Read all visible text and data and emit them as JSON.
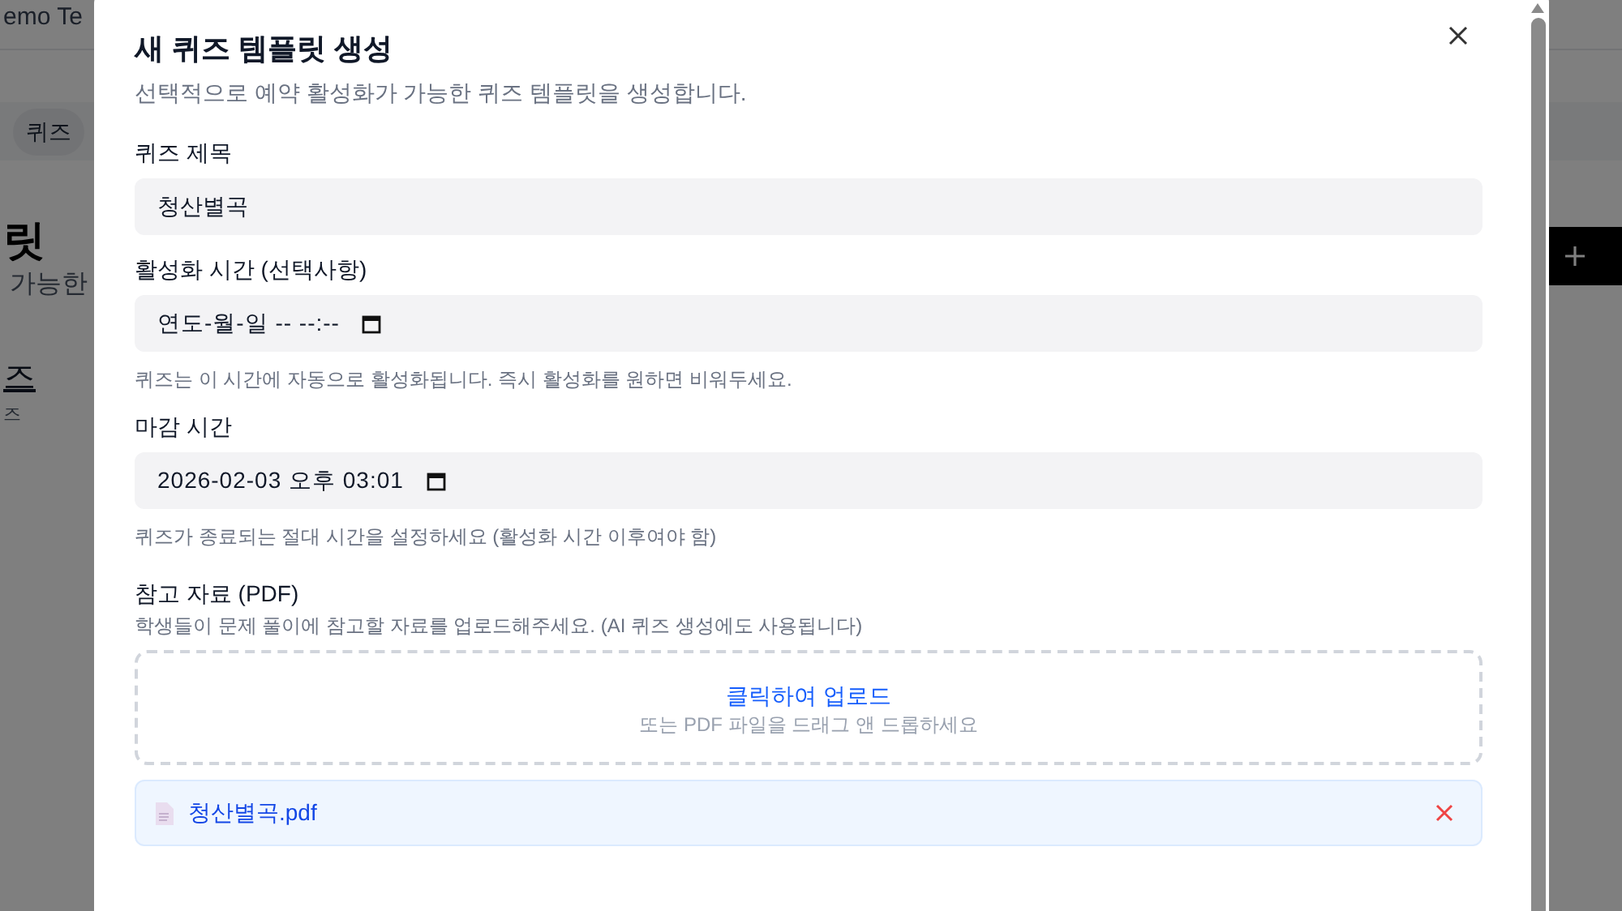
{
  "background": {
    "header_text": "emo Te",
    "chip": "퀴즈",
    "heading": "릿",
    "subheading": "가능한",
    "item_title": "즈",
    "item_sub": "즈"
  },
  "dialog": {
    "title": "새 퀴즈 템플릿 생성",
    "description": "선택적으로 예약 활성화가 가능한 퀴즈 템플릿을 생성합니다.",
    "fields": [
      {
        "kind": "text",
        "label": "퀴즈 제목",
        "value": "청산별곡"
      },
      {
        "kind": "datetime",
        "label": "활성화 시간 (선택사항)",
        "placeholder": "연도-월-일 -- --:--",
        "hint": "퀴즈는 이 시간에 자동으로 활성화됩니다. 즉시 활성화를 원하면 비워두세요."
      },
      {
        "kind": "datetime",
        "label": "마감 시간",
        "value": "2026-02-03 오후 03:01",
        "hint": "퀴즈가 종료되는 절대 시간을 설정하세요 (활성화 시간 이후여야 함)"
      }
    ],
    "upload": {
      "label": "참고 자료 (PDF)",
      "hint": "학생들이 문제 풀이에 참고할 자료를 업로드해주세요. (AI 퀴즈 생성에도 사용됩니다)",
      "action": "클릭하여 업로드",
      "sub": "또는 PDF 파일을 드래그 앤 드롭하세요",
      "files": [
        "청산별곡.pdf"
      ]
    }
  }
}
